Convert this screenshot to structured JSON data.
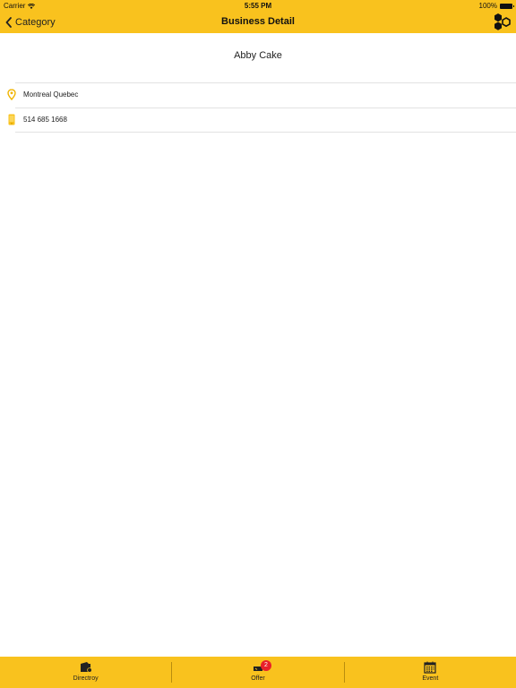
{
  "status_bar": {
    "carrier": "Carrier",
    "time": "5:55 PM",
    "battery": "100%"
  },
  "nav": {
    "back_label": "Category",
    "title": "Business Detail",
    "logo_icon": "hexagon-logo-icon"
  },
  "business": {
    "name": "Abby Cake",
    "details": [
      {
        "icon": "location-pin-icon",
        "text": "Montreal Quebec"
      },
      {
        "icon": "phone-icon",
        "text": "514 685 1668"
      }
    ]
  },
  "tab_bar": {
    "tabs": [
      {
        "label": "Directroy",
        "icon": "directory-icon"
      },
      {
        "label": "Offer",
        "icon": "offer-icon",
        "badge": "2"
      },
      {
        "label": "Event",
        "icon": "calendar-icon"
      }
    ]
  },
  "colors": {
    "accent": "#f9c21e",
    "badge": "#e8202a"
  }
}
